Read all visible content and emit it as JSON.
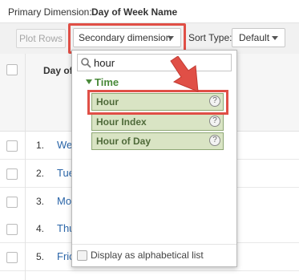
{
  "header": {
    "primary_label": "Primary Dimension:",
    "primary_value": "Day of Week Name"
  },
  "toolbar": {
    "plot_rows_label": "Plot Rows",
    "secondary_dimension_label": "Secondary dimension",
    "sort_type_label": "Sort Type:",
    "sort_type_value": "Default"
  },
  "table": {
    "column_header": "Day of",
    "rows": [
      {
        "num": "1.",
        "name": "We"
      },
      {
        "num": "2.",
        "name": "Tue"
      },
      {
        "num": "3.",
        "name": "Mo"
      },
      {
        "num": "4.",
        "name": "Thu"
      },
      {
        "num": "5.",
        "name": "Fric"
      }
    ]
  },
  "dropdown": {
    "search_value": "hour",
    "group_label": "Time",
    "items": [
      {
        "label": "Hour",
        "help": "?"
      },
      {
        "label": "Hour Index",
        "help": "?"
      },
      {
        "label": "Hour of Day",
        "help": "?"
      }
    ],
    "alpha_label": "Display as alphabetical list"
  },
  "colors": {
    "highlight": "#e04f46",
    "group_green": "#4a8a3a",
    "item_bg": "#d9e4c4",
    "link_blue": "#2a65a8"
  },
  "icons": {
    "search": "search-icon",
    "help": "help-icon",
    "caret": "chevron-down-icon",
    "annotation": "arrow-icon"
  }
}
